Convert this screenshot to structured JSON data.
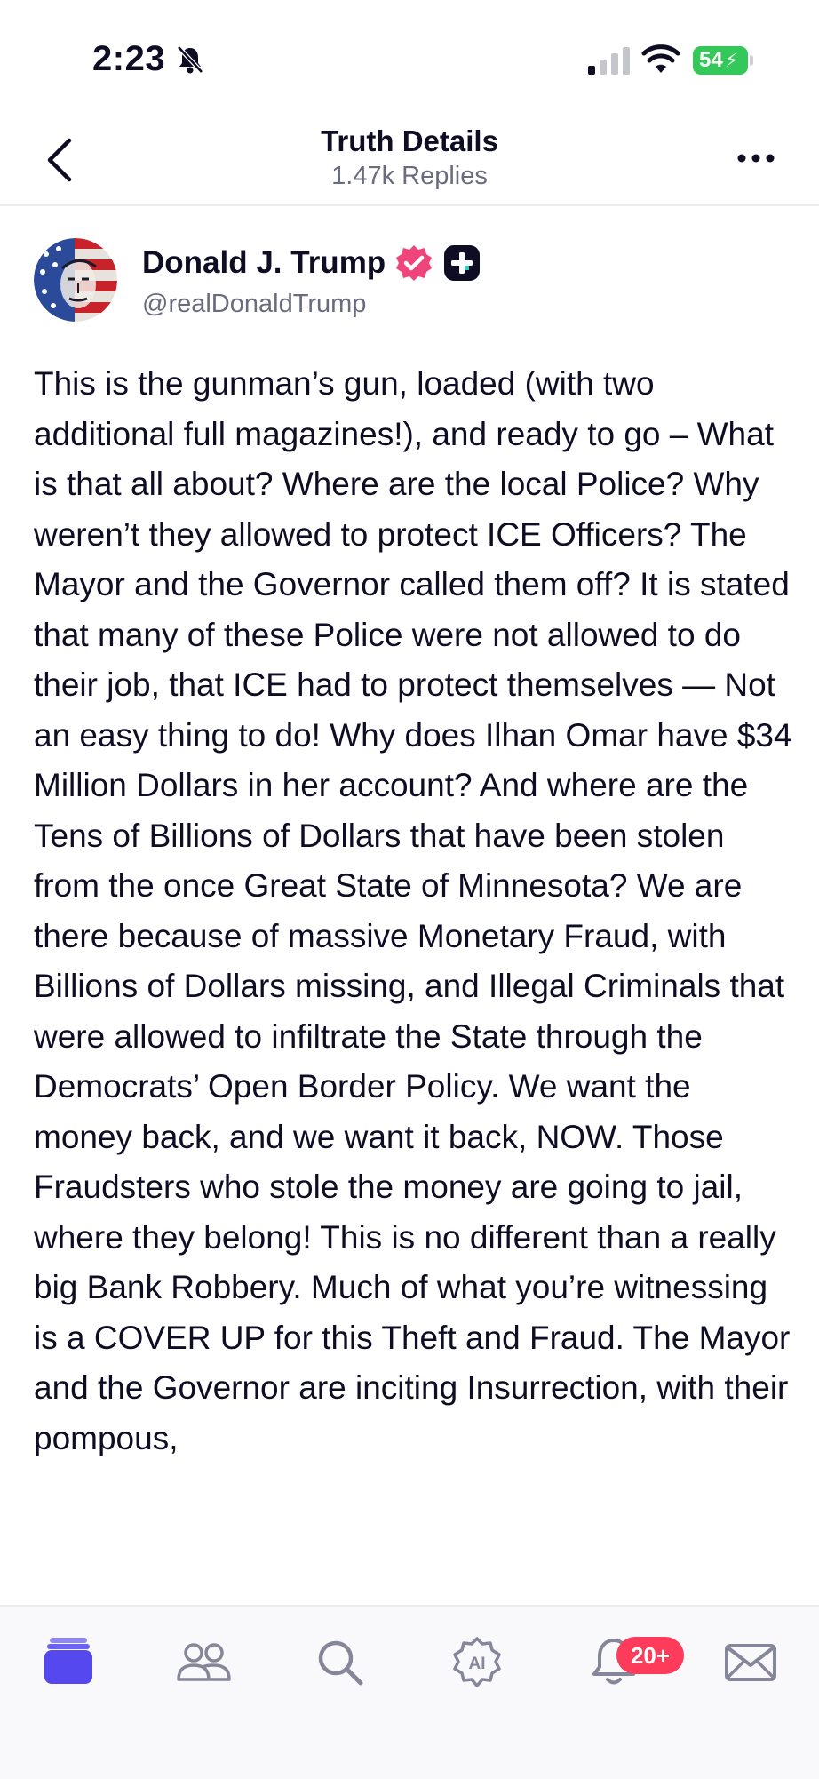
{
  "status_bar": {
    "time": "2:23",
    "battery": "54",
    "icons": [
      "bell-slash-icon",
      "cellular-signal-icon",
      "wifi-icon",
      "battery-charging-icon"
    ]
  },
  "header": {
    "title": "Truth Details",
    "subtitle": "1.47k Replies",
    "icons": [
      "back-chevron-icon",
      "more-options-icon"
    ]
  },
  "post": {
    "author_name": "Donald J. Trump",
    "handle": "@realDonaldTrump",
    "badges": [
      "verified-check-icon",
      "truth-plus-icon"
    ],
    "text": "This is the gunman’s gun, loaded (with two additional full magazines!), and ready to go – What is that all about? Where are the local Police? Why weren’t they allowed to protect ICE Officers? The Mayor and the Governor called them off? It is stated that many of these Police were not allowed to do their job, that ICE had to protect themselves — Not an easy thing to do! Why does Ilhan Omar have $34 Million Dollars in her account? And where are the Tens of Billions of Dollars that have been stolen from the once Great State of Minnesota? We are there because of massive Monetary Fraud, with Billions of Dollars missing, and Illegal Criminals that were allowed to infiltrate the State through the Democrats’ Open Border Policy. We want the money back, and we want it back, NOW. Those Fraudsters who stole the money are going to jail, where they belong! This is no different than a really big Bank Robbery. Much of what you’re witnessing is a COVER UP for this Theft and Fraud. The Mayor and the Governor are inciting Insurrection, with their pompous,"
  },
  "tab_bar": {
    "tabs": [
      "feed-icon",
      "groups-icon",
      "search-icon",
      "ai-icon",
      "notifications-bell-icon",
      "messages-envelope-icon"
    ],
    "notification_badge": "20+"
  },
  "colors": {
    "accent": "#5448ee",
    "verified": "#f0457a",
    "battery": "#34c759",
    "badge": "#ff3b5c",
    "text": "#0e0d24",
    "muted": "#6b6b80"
  }
}
